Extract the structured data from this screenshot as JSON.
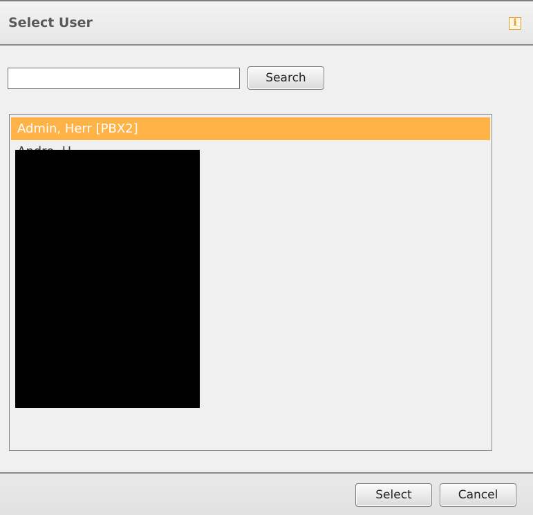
{
  "dialog": {
    "title": "Select User",
    "info_icon": "info-icon",
    "info_glyph": "i"
  },
  "search": {
    "value": "",
    "placeholder": "",
    "button_label": "Search"
  },
  "user_list": {
    "items": [
      {
        "label": "Admin, Herr [PBX2]",
        "selected": true
      },
      {
        "label": "Andre, H...",
        "selected": false,
        "redacted": true
      }
    ],
    "selected_color": "#ffb347",
    "redacted_region": "redaction-block"
  },
  "footer": {
    "select_label": "Select",
    "cancel_label": "Cancel"
  }
}
